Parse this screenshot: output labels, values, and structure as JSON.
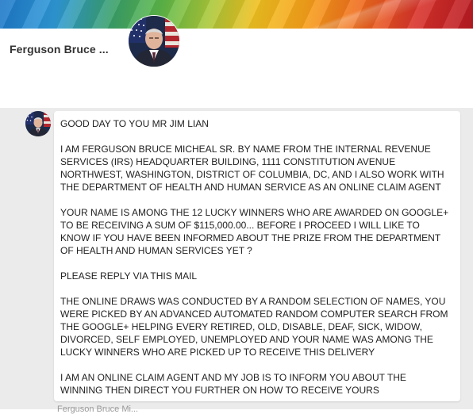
{
  "profile": {
    "name": "Ferguson Bruce ..."
  },
  "message": {
    "paragraphs": [
      "GOOD DAY TO YOU MR JIM LIAN",
      "I AM FERGUSON BRUCE MICHEAL SR. BY NAME FROM THE INTERNAL REVENUE\nSERVICES (IRS) HEADQUARTER BUILDING, 1111 CONSTITUTION AVENUE\nNORTHWEST, WASHINGTON, DISTRICT OF COLUMBIA, DC, AND I ALSO WORK WITH\nTHE DEPARTMENT OF HEALTH AND HUMAN SERVICE AS AN ONLINE CLAIM AGENT",
      "YOUR NAME IS AMONG THE 12 LUCKY WINNERS WHO ARE AWARDED ON GOOGLE+\nTO BE RECEIVING A SUM OF $115,000.00... BEFORE I PROCEED I WILL LIKE TO\nKNOW IF YOU HAVE BEEN INFORMED ABOUT THE PRIZE FROM THE DEPARTMENT\nOF HEALTH AND HUMAN SERVICES YET ?",
      "PLEASE REPLY VIA THIS MAIL",
      "THE ONLINE DRAWS WAS CONDUCTED BY A RANDOM SELECTION OF NAMES, YOU\nWERE PICKED BY AN ADVANCED AUTOMATED RANDOM COMPUTER SEARCH FROM\nTHE GOOGLE+ HELPING EVERY RETIRED, OLD, DISABLE, DEAF, SICK, WIDOW,\nDIVORCED, SELF EMPLOYED, UNEMPLOYED AND YOUR NAME WAS AMONG THE\nLUCKY WINNERS WHO ARE PICKED UP TO RECEIVE THIS DELIVERY",
      "I AM AN ONLINE CLAIM AGENT AND MY JOB IS TO INFORM YOU ABOUT THE\nWINNING THEN DIRECT YOU FURTHER ON HOW TO RECEIVE YOURS"
    ],
    "truncated_footer": "Ferguson Bruce Mi..."
  },
  "icons": {
    "profile_avatar": "person-portrait-icon",
    "sender_avatar": "person-portrait-icon"
  },
  "colors": {
    "feed_background": "#ebebeb",
    "card_background": "#ffffff",
    "name_text": "#333333"
  }
}
